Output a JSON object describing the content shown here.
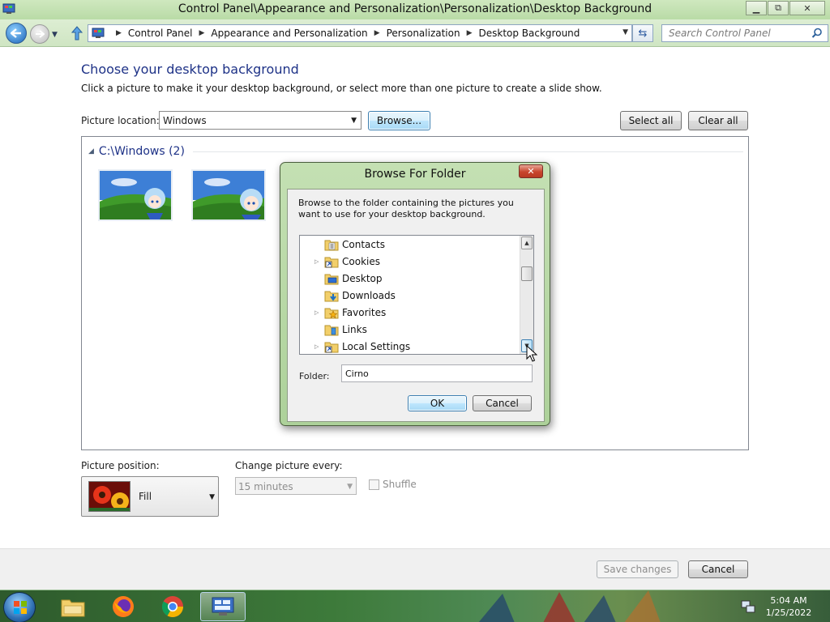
{
  "window": {
    "title": "Control Panel\\Appearance and Personalization\\Personalization\\Desktop Background",
    "min_label": "▭",
    "max_label": "⧉",
    "close_label": "✕"
  },
  "address": {
    "breadcrumbs": [
      "Control Panel",
      "Appearance and Personalization",
      "Personalization",
      "Desktop Background"
    ],
    "search_placeholder": "Search Control Panel"
  },
  "page": {
    "heading": "Choose your desktop background",
    "subtitle": "Click a picture to make it your desktop background, or select more than one picture to create a slide show.",
    "location_label": "Picture location:",
    "location_value": "Windows",
    "browse_label": "Browse...",
    "select_all_label": "Select all",
    "clear_all_label": "Clear all",
    "group_title": "C:\\Windows (2)"
  },
  "dialog": {
    "title": "Browse For Folder",
    "close_label": "✕",
    "description": "Browse to the folder containing the pictures you want to use for your desktop background.",
    "tree": [
      {
        "label": "Contacts",
        "expander": false,
        "icon": "contacts-folder-icon"
      },
      {
        "label": "Cookies",
        "expander": true,
        "icon": "shortcut-folder-icon"
      },
      {
        "label": "Desktop",
        "expander": false,
        "icon": "desktop-folder-icon"
      },
      {
        "label": "Downloads",
        "expander": false,
        "icon": "downloads-folder-icon"
      },
      {
        "label": "Favorites",
        "expander": true,
        "icon": "favorites-folder-icon"
      },
      {
        "label": "Links",
        "expander": false,
        "icon": "links-folder-icon"
      },
      {
        "label": "Local Settings",
        "expander": true,
        "icon": "shortcut-folder-icon"
      }
    ],
    "folder_label": "Folder:",
    "folder_value": "Cirno",
    "ok_label": "OK",
    "cancel_label": "Cancel"
  },
  "options": {
    "position_label": "Picture position:",
    "position_value": "Fill",
    "change_label": "Change picture every:",
    "change_value": "15 minutes",
    "shuffle_label": "Shuffle"
  },
  "footer": {
    "save_label": "Save changes",
    "cancel_label": "Cancel"
  },
  "taskbar": {
    "time": "5:04 AM",
    "date": "1/25/2022",
    "apps": [
      "explorer-icon",
      "firefox-icon",
      "chrome-icon",
      "control-panel-icon"
    ]
  },
  "colors": {
    "title_bar": "#c4e0b3",
    "heading": "#1e3287",
    "accent_button": "#3c7fb1"
  }
}
